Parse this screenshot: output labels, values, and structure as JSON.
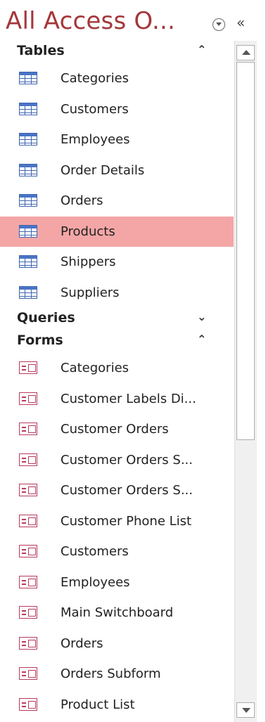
{
  "header": {
    "title": "All Access O...",
    "collapse_glyph": "«"
  },
  "groups": {
    "tables": {
      "label": "Tables",
      "chevron": "⌃",
      "items": [
        {
          "label": "Categories"
        },
        {
          "label": "Customers"
        },
        {
          "label": "Employees"
        },
        {
          "label": "Order Details"
        },
        {
          "label": "Orders"
        },
        {
          "label": "Products",
          "selected": true
        },
        {
          "label": "Shippers"
        },
        {
          "label": "Suppliers"
        }
      ]
    },
    "queries": {
      "label": "Queries",
      "chevron": "⌄"
    },
    "forms": {
      "label": "Forms",
      "chevron": "⌃",
      "items": [
        {
          "label": "Categories"
        },
        {
          "label": "Customer Labels Di..."
        },
        {
          "label": "Customer Orders"
        },
        {
          "label": "Customer Orders S..."
        },
        {
          "label": "Customer Orders S..."
        },
        {
          "label": "Customer Phone List"
        },
        {
          "label": "Customers"
        },
        {
          "label": "Employees"
        },
        {
          "label": "Main Switchboard"
        },
        {
          "label": "Orders"
        },
        {
          "label": "Orders Subform"
        },
        {
          "label": "Product List"
        }
      ]
    }
  },
  "icons": {
    "table": "table-icon",
    "form": "form-icon"
  },
  "colors": {
    "title": "#a4373a",
    "selected_bg": "#f4a6a6"
  }
}
